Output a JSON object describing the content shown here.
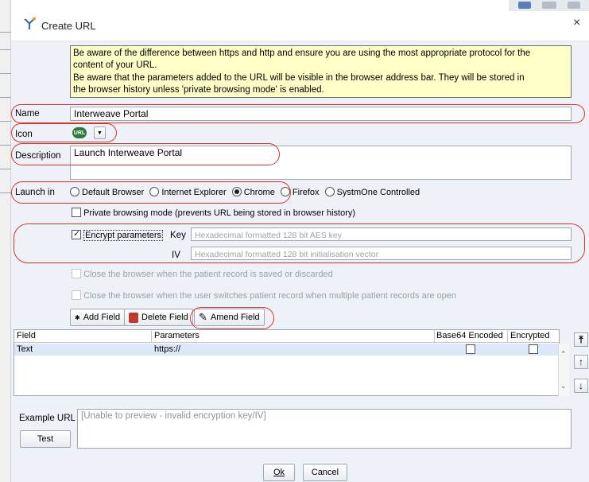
{
  "dialog": {
    "title": "Create URL",
    "close_glyph": "×"
  },
  "info_text": {
    "line1": "Be aware of the difference between https and http and ensure you are using the most appropriate protocol for the",
    "line2": "content of your URL.",
    "line3": "Be aware that the parameters added to the URL will be visible in the browser address bar. They will be stored in",
    "line4": "the browser history unless 'private browsing mode' is enabled."
  },
  "form": {
    "name_label": "Name",
    "name_value": "Interweave Portal",
    "icon_label": "Icon",
    "icon_badge": "URL",
    "description_label": "Description",
    "description_value": "Launch Interweave Portal",
    "launch_label": "Launch in",
    "launch_options": [
      "Default Browser",
      "Internet Explorer",
      "Chrome",
      "Firefox",
      "SystmOne Controlled"
    ],
    "launch_selected": "Chrome",
    "private_browsing_label": "Private browsing mode (prevents URL being stored in browser history)",
    "private_browsing_checked": false,
    "encrypt_label": "Encrypt parameters",
    "encrypt_checked": true,
    "key_label": "Key",
    "key_placeholder": "Hexadecimal formatted 128 bit AES key",
    "iv_label": "IV",
    "iv_placeholder": "Hexadecimal formatted 128 bit initialisation vector",
    "close_on_save_label": "Close the browser when the patient record is saved or discarded",
    "close_on_switch_label": "Close the browser when the user switches patient record when multiple patient records are open"
  },
  "field_buttons": {
    "add": "Add Field",
    "delete": "Delete Field",
    "amend": "Amend Field"
  },
  "table": {
    "columns": [
      "Field",
      "Parameters",
      "Base64 Encoded",
      "Encrypted"
    ],
    "rows": [
      {
        "field": "Text",
        "parameters": "https://",
        "base64": false,
        "encrypted": false
      }
    ]
  },
  "example": {
    "label": "Example URL",
    "value": "[Unable to preview - invalid encryption key/IV]",
    "test_button": "Test"
  },
  "footer": {
    "ok": "Ok",
    "cancel": "Cancel"
  },
  "colors": {
    "highlight": "#d9342b",
    "info_bg": "#ffffc8",
    "dialog_bg": "#eef2f8",
    "selected_row": "#dce8f7"
  }
}
